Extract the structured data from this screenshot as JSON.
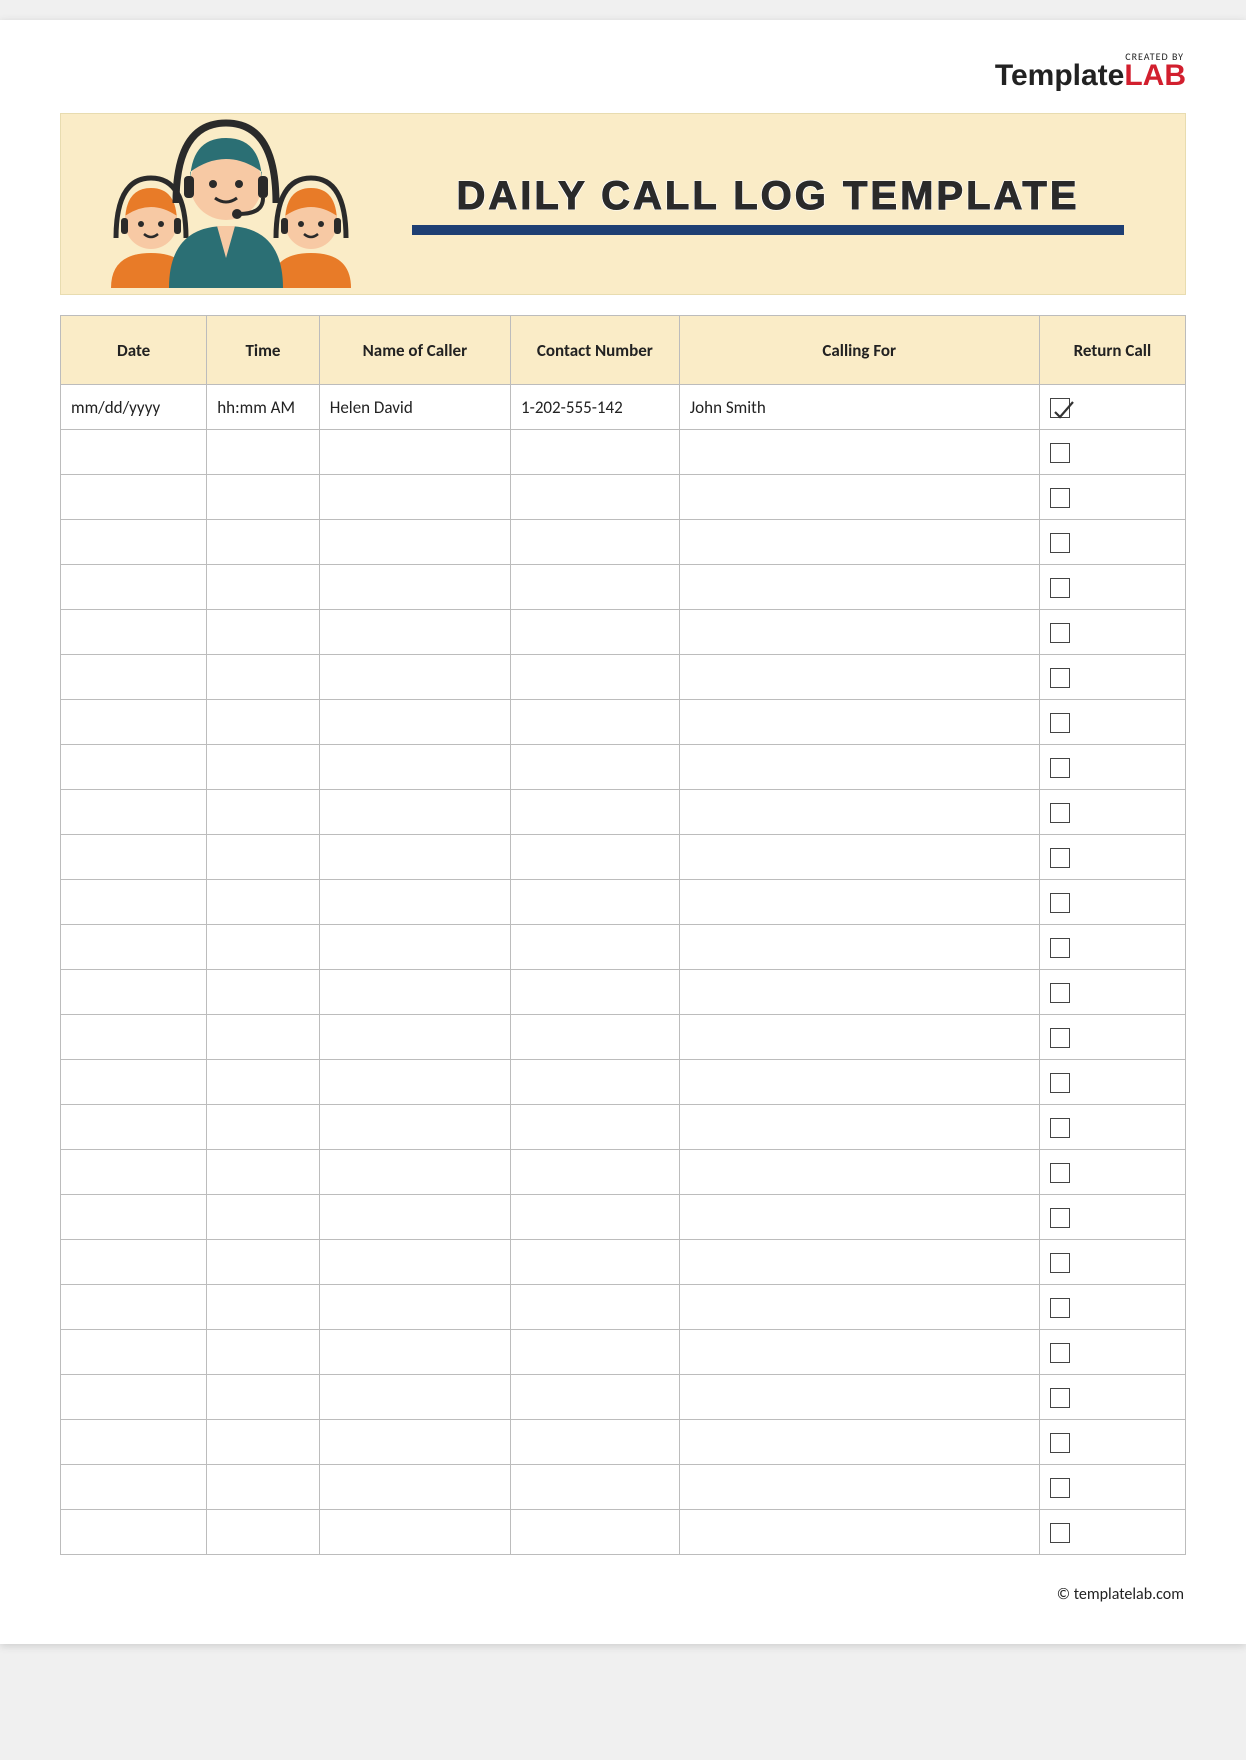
{
  "brand": {
    "created_by": "CREATED BY",
    "name_part1": "Template",
    "name_part2": "LAB"
  },
  "banner": {
    "title": "DAILY CALL LOG TEMPLATE"
  },
  "columns": {
    "date": "Date",
    "time": "Time",
    "name": "Name of Caller",
    "contact": "Contact Number",
    "calling_for": "Calling For",
    "return_call": "Return Call"
  },
  "rows": [
    {
      "date": "mm/dd/yyyy",
      "time": "hh:mm AM",
      "name": "Helen David",
      "contact": "1-202-555-142",
      "calling_for": "John Smith",
      "return": true
    },
    {
      "date": "",
      "time": "",
      "name": "",
      "contact": "",
      "calling_for": "",
      "return": false
    },
    {
      "date": "",
      "time": "",
      "name": "",
      "contact": "",
      "calling_for": "",
      "return": false
    },
    {
      "date": "",
      "time": "",
      "name": "",
      "contact": "",
      "calling_for": "",
      "return": false
    },
    {
      "date": "",
      "time": "",
      "name": "",
      "contact": "",
      "calling_for": "",
      "return": false
    },
    {
      "date": "",
      "time": "",
      "name": "",
      "contact": "",
      "calling_for": "",
      "return": false
    },
    {
      "date": "",
      "time": "",
      "name": "",
      "contact": "",
      "calling_for": "",
      "return": false
    },
    {
      "date": "",
      "time": "",
      "name": "",
      "contact": "",
      "calling_for": "",
      "return": false
    },
    {
      "date": "",
      "time": "",
      "name": "",
      "contact": "",
      "calling_for": "",
      "return": false
    },
    {
      "date": "",
      "time": "",
      "name": "",
      "contact": "",
      "calling_for": "",
      "return": false
    },
    {
      "date": "",
      "time": "",
      "name": "",
      "contact": "",
      "calling_for": "",
      "return": false
    },
    {
      "date": "",
      "time": "",
      "name": "",
      "contact": "",
      "calling_for": "",
      "return": false
    },
    {
      "date": "",
      "time": "",
      "name": "",
      "contact": "",
      "calling_for": "",
      "return": false
    },
    {
      "date": "",
      "time": "",
      "name": "",
      "contact": "",
      "calling_for": "",
      "return": false
    },
    {
      "date": "",
      "time": "",
      "name": "",
      "contact": "",
      "calling_for": "",
      "return": false
    },
    {
      "date": "",
      "time": "",
      "name": "",
      "contact": "",
      "calling_for": "",
      "return": false
    },
    {
      "date": "",
      "time": "",
      "name": "",
      "contact": "",
      "calling_for": "",
      "return": false
    },
    {
      "date": "",
      "time": "",
      "name": "",
      "contact": "",
      "calling_for": "",
      "return": false
    },
    {
      "date": "",
      "time": "",
      "name": "",
      "contact": "",
      "calling_for": "",
      "return": false
    },
    {
      "date": "",
      "time": "",
      "name": "",
      "contact": "",
      "calling_for": "",
      "return": false
    },
    {
      "date": "",
      "time": "",
      "name": "",
      "contact": "",
      "calling_for": "",
      "return": false
    },
    {
      "date": "",
      "time": "",
      "name": "",
      "contact": "",
      "calling_for": "",
      "return": false
    },
    {
      "date": "",
      "time": "",
      "name": "",
      "contact": "",
      "calling_for": "",
      "return": false
    },
    {
      "date": "",
      "time": "",
      "name": "",
      "contact": "",
      "calling_for": "",
      "return": false
    },
    {
      "date": "",
      "time": "",
      "name": "",
      "contact": "",
      "calling_for": "",
      "return": false
    },
    {
      "date": "",
      "time": "",
      "name": "",
      "contact": "",
      "calling_for": "",
      "return": false
    }
  ],
  "footer": {
    "credit": "© templatelab.com"
  },
  "colors": {
    "banner_bg": "#faecc7",
    "underline": "#1e3f73",
    "accent_red": "#d21f2e",
    "teal": "#2b6f74",
    "orange": "#e87b28"
  }
}
